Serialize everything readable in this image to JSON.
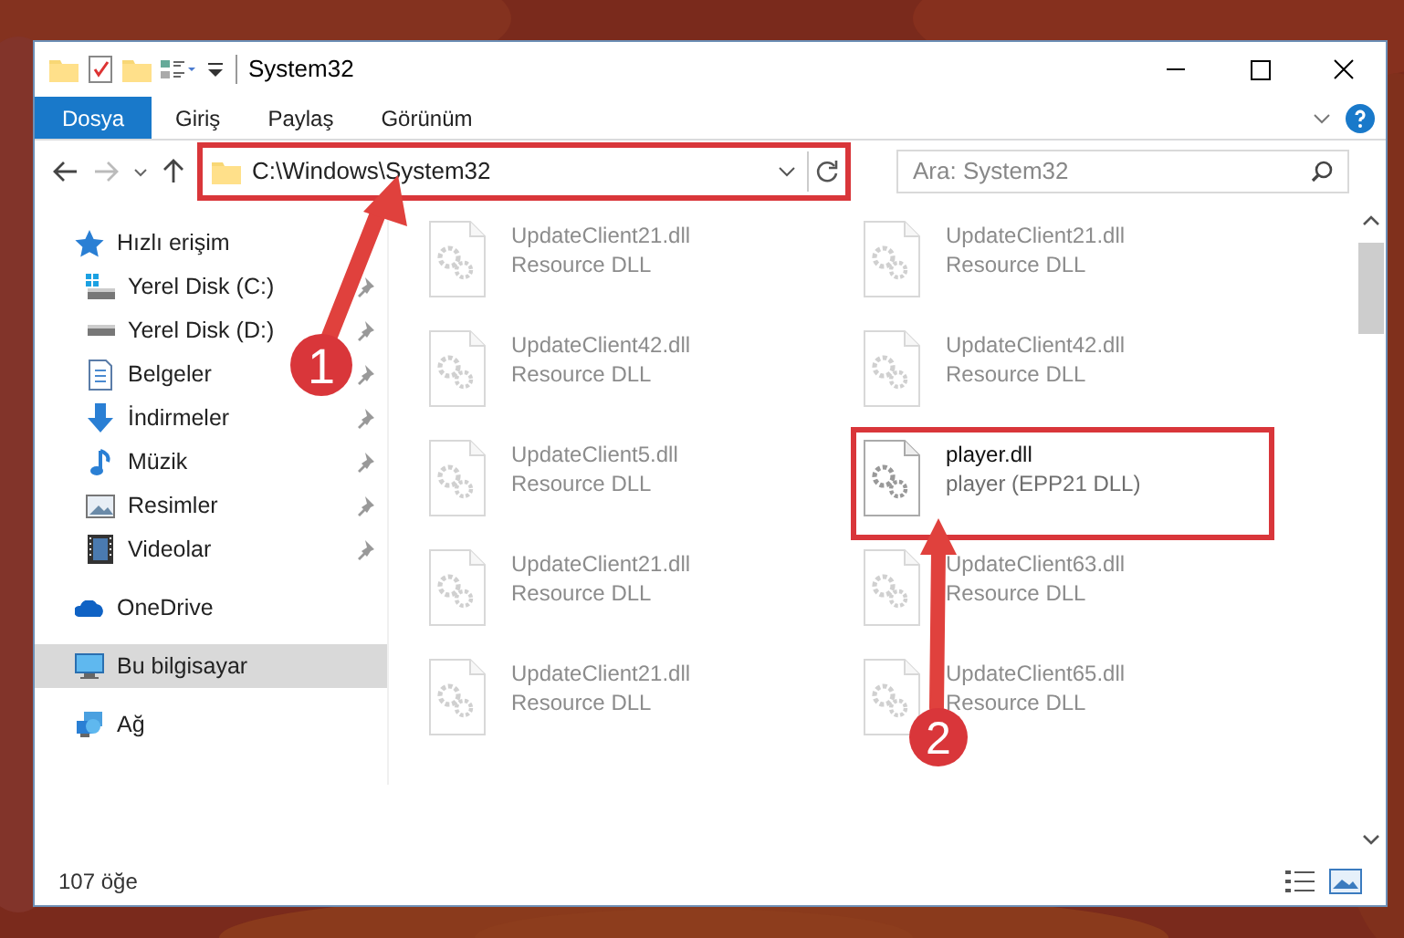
{
  "window": {
    "title": "System32"
  },
  "ribbon_tabs": [
    {
      "label": "Dosya",
      "kind": "file",
      "selected": false
    },
    {
      "label": "Giriş",
      "kind": "tab",
      "selected": false
    },
    {
      "label": "Paylaş",
      "kind": "tab",
      "selected": false
    },
    {
      "label": "Görünüm",
      "kind": "tab",
      "selected": false
    }
  ],
  "address_bar": {
    "path": "C:\\Windows\\System32",
    "highlighted": true
  },
  "search": {
    "placeholder": "Ara: System32"
  },
  "sidebar": {
    "items": [
      {
        "label": "Hızlı erişim",
        "kind": "star",
        "selected": false,
        "children": [
          {
            "label": "Yerel Disk (C:)",
            "kind": "system-drive",
            "pinned": true,
            "selected": false
          },
          {
            "label": "Yerel Disk (D:)",
            "kind": "drive",
            "pinned": true,
            "selected": false
          },
          {
            "label": "Belgeler",
            "kind": "document",
            "pinned": true,
            "selected": false
          },
          {
            "label": "İndirmeler",
            "kind": "download",
            "pinned": true,
            "selected": false
          },
          {
            "label": "Müzik",
            "kind": "music",
            "pinned": true,
            "selected": false
          },
          {
            "label": "Resimler",
            "pinned": true,
            "selected": false
          },
          {
            "label": "Videolar",
            "kind": "video",
            "pinned": true,
            "selected": false
          }
        ]
      },
      {
        "label": "OneDrive",
        "kind": "cloud",
        "selected": false
      },
      {
        "label": "Bu bilgisayar",
        "kind": "computer",
        "selected": true
      },
      {
        "label": "Ağ",
        "kind": "network",
        "selected": false
      }
    ]
  },
  "files": [
    {
      "name": "UpdateClient21.dll",
      "type": "Resource DLL",
      "blurred": true,
      "highlighted": false
    },
    {
      "name": "UpdateClient21.dll",
      "type": "Resource DLL",
      "blurred": true,
      "highlighted": false
    },
    {
      "name": "UpdateClient42.dll",
      "type": "Resource DLL",
      "blurred": true,
      "highlighted": false
    },
    {
      "name": "UpdateClient42.dll",
      "type": "Resource DLL",
      "blurred": true,
      "highlighted": false
    },
    {
      "name": "UpdateClient5.dll",
      "type": "Resource DLL",
      "blurred": true,
      "highlighted": false
    },
    {
      "name": "player.dll",
      "type": "player (EPP21 DLL)",
      "blurred": false,
      "highlighted": true
    },
    {
      "name": "UpdateClient21.dll",
      "type": "Resource DLL",
      "blurred": true,
      "highlighted": false
    },
    {
      "name": "UpdateClient63.dll",
      "type": "Resource DLL",
      "blurred": true,
      "highlighted": false
    },
    {
      "name": "UpdateClient21.dll",
      "type": "Resource DLL",
      "blurred": true,
      "highlighted": false
    },
    {
      "name": "UpdateClient65.dll",
      "type": "Resource DLL",
      "blurred": true,
      "highlighted": false
    }
  ],
  "status_bar": {
    "item_count": "107 öğe"
  },
  "annotations": [
    {
      "label": "1"
    },
    {
      "label": "2"
    }
  ]
}
